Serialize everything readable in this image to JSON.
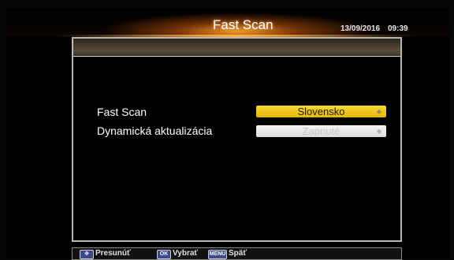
{
  "header": {
    "title": "Fast Scan",
    "date": "13/09/2016",
    "time": "09:39"
  },
  "settings": [
    {
      "label": "Fast Scan",
      "value": "Slovensko",
      "state": "selected"
    },
    {
      "label": "Dynamická aktualizácia",
      "value": "Zapnuté",
      "state": "disabled"
    }
  ],
  "footer": {
    "move_key": "✥",
    "move_label": "Presunúť",
    "ok_key": "OK",
    "ok_label": "Vybrať",
    "menu_key": "MENU",
    "menu_label": "Späť"
  },
  "colors": {
    "accent": "#f0c820",
    "glow": "#ffa028"
  }
}
